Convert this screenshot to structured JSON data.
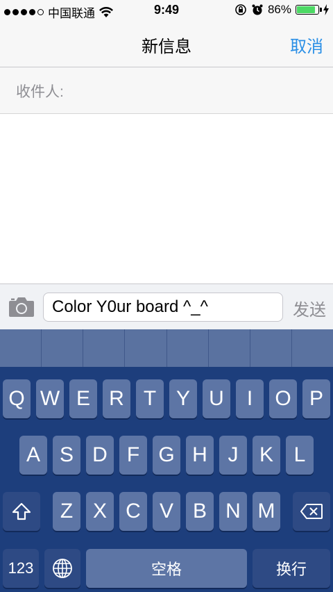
{
  "status": {
    "carrier": "中国联通",
    "time": "9:49",
    "battery_percent": "86%",
    "battery_level": 0.86,
    "signal_bars": 4,
    "accent_battery": "#4cd964"
  },
  "nav": {
    "title": "新信息",
    "cancel_label": "取消",
    "accent": "#2a8fe6"
  },
  "recipient": {
    "label": "收件人:"
  },
  "compose": {
    "text": "Color Y0ur board ^_^",
    "send_label": "发送"
  },
  "keyboard": {
    "row1": [
      "Q",
      "W",
      "E",
      "R",
      "T",
      "Y",
      "U",
      "I",
      "O",
      "P"
    ],
    "row2": [
      "A",
      "S",
      "D",
      "F",
      "G",
      "H",
      "J",
      "K",
      "L"
    ],
    "row3": [
      "Z",
      "X",
      "C",
      "V",
      "B",
      "N",
      "M"
    ],
    "numbers_label": "123",
    "space_label": "空格",
    "return_label": "换行",
    "icons": [
      "shift-icon",
      "delete-icon",
      "globe-icon"
    ]
  }
}
